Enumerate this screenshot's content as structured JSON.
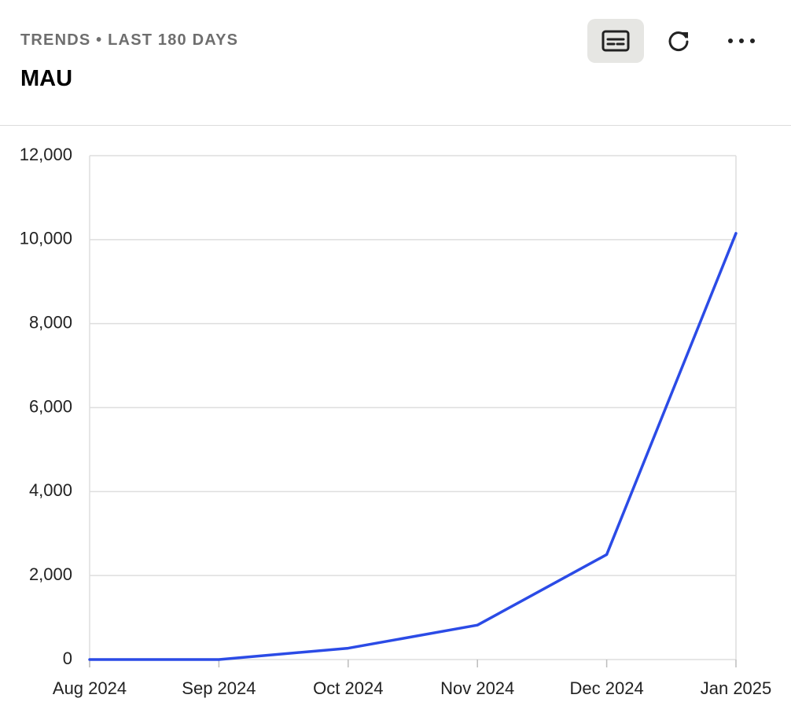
{
  "header": {
    "subtitle": "TRENDS • LAST 180 DAYS",
    "title": "MAU",
    "buttons": [
      {
        "icon": "subtitles-icon",
        "active": true
      },
      {
        "icon": "refresh-icon",
        "active": false
      },
      {
        "icon": "more-horizontal-icon",
        "active": false
      }
    ]
  },
  "colors": {
    "line": "#2b4be6",
    "grid": "#dedede",
    "axis_text": "#222222",
    "active_button_bg": "#e6e6e3"
  },
  "chart_data": {
    "type": "line",
    "categories": [
      "Aug 2024",
      "Sep 2024",
      "Oct 2024",
      "Nov 2024",
      "Dec 2024",
      "Jan 2025"
    ],
    "series": [
      {
        "values": [
          0,
          0,
          270,
          820,
          2500,
          10150
        ]
      }
    ],
    "yticks": [
      "0",
      "2,000",
      "4,000",
      "6,000",
      "8,000",
      "10,000",
      "12,000"
    ],
    "ylim": [
      0,
      12000
    ],
    "grid": true,
    "legend": "none"
  }
}
